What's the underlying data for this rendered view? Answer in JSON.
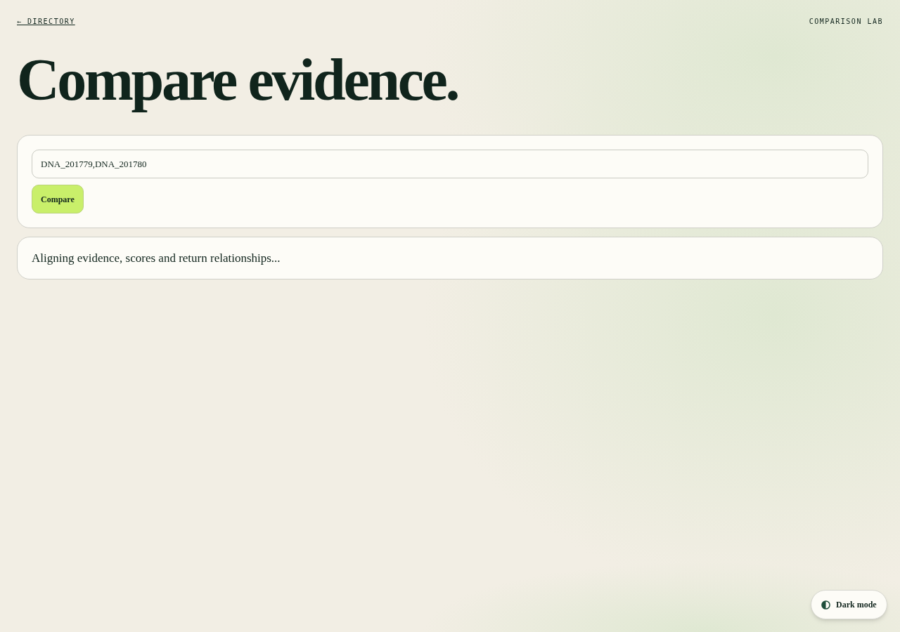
{
  "nav": {
    "back_link": "← DIRECTORY",
    "section_label": "COMPARISON LAB"
  },
  "heading": "Compare evidence.",
  "form": {
    "value": "DNA_201779,DNA_201780",
    "button": "Compare"
  },
  "status_message": "Aligning evidence, scores and return relationships...",
  "theme_toggle": {
    "label": "Dark mode"
  }
}
